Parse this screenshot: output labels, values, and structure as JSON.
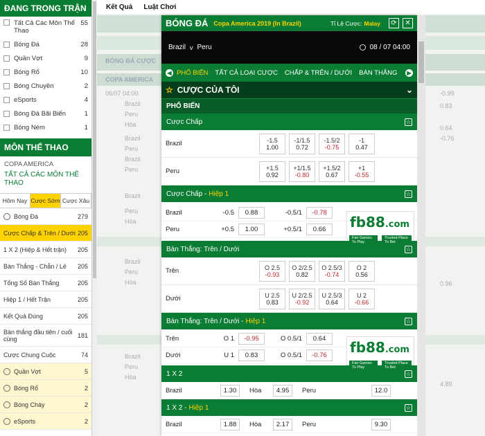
{
  "left": {
    "live_title": "ĐANG TRONG TRẬN",
    "live_items": [
      {
        "label": "Tất Cả Các Môn Thể Thao",
        "count": "55"
      },
      {
        "label": "Bóng Đá",
        "count": "28"
      },
      {
        "label": "Quần Vợt",
        "count": "9"
      },
      {
        "label": "Bóng Rổ",
        "count": "10"
      },
      {
        "label": "Bóng Chuyền",
        "count": "2"
      },
      {
        "label": "eSports",
        "count": "4"
      },
      {
        "label": "Bóng Đá Bãi Biển",
        "count": "1"
      },
      {
        "label": "Bóng Ném",
        "count": "1"
      }
    ],
    "sports_title": "MÔN THỂ THAO",
    "copa": "COPA AMERICA",
    "all_sports": "TẤT CẢ CÁC MÔN THỂ THAO",
    "tabs": [
      "Hôm Nay",
      "Cược Sớm",
      "Cược Xâu"
    ],
    "sport_items": [
      {
        "label": "Bóng Đá",
        "count": "279"
      },
      {
        "label": "Cược Chấp & Trên / Dưới",
        "count": "205"
      },
      {
        "label": "1 X 2 (Hiệp & Hết trận)",
        "count": "205"
      },
      {
        "label": "Bàn Thắng - Chẵn / Lẻ",
        "count": "205"
      },
      {
        "label": "Tổng Số Bàn Thắng",
        "count": "205"
      },
      {
        "label": "Hiệp 1 / Hết Trận",
        "count": "205"
      },
      {
        "label": "Kết Quả Đúng",
        "count": "205"
      },
      {
        "label": "Bàn thắng đầu tiên / cuối cùng",
        "count": "181"
      },
      {
        "label": "Cược Chung Cuộc",
        "count": "74"
      },
      {
        "label": "Quần Vợt",
        "count": "5"
      },
      {
        "label": "Bóng Rổ",
        "count": "2"
      },
      {
        "label": "Bóng Chày",
        "count": "2"
      },
      {
        "label": "eSports",
        "count": "2"
      }
    ]
  },
  "topnav": {
    "results": "Kết Quả",
    "rules": "Luật Chơi"
  },
  "bg": {
    "sec1": "BÓNG ĐÁ CƯỢC",
    "sec2": "COPA AMERICA",
    "bg_texts": [
      "Brazil",
      "Peru",
      "Hòa",
      "Brazil",
      "Peru",
      "Brazil",
      "Peru",
      "Brazil",
      "Peru",
      "Hòa",
      "06/07 04:00",
      "Brazil",
      "Peru",
      "Hòa",
      "Brazil",
      "Peru",
      "Hòa"
    ],
    "right_vals": [
      "-0.99",
      "0.83",
      "0.64",
      "-0.76",
      "0.96",
      "4.89"
    ]
  },
  "modal": {
    "title": "BÓNG ĐÁ",
    "league": "Copa America 2019 (In Brazil)",
    "odds_label": "Tỉ Lệ Cược:",
    "odds_type": "Malay",
    "home": "Brazil",
    "vs": "v",
    "away": "Peru",
    "datetime": "08 / 07  04:00",
    "tabs": [
      "PHỔ BIẾN",
      "TẤT CẢ LOẠI CƯỢC",
      "CHẤP & TRÊN / DƯỚI",
      "BÀN THẮNG"
    ],
    "my_bets": "CƯỢC CỦA TÔI",
    "popular": "PHỔ BIẾN",
    "handicap": {
      "title": "Cược Chấp",
      "rows": [
        {
          "team": "Brazil",
          "odds": [
            [
              "-1.5",
              "1.00"
            ],
            [
              "-1/1.5",
              "0.72"
            ],
            [
              "-1.5/2",
              "-0.75"
            ],
            [
              "-1",
              "0.47"
            ]
          ]
        },
        {
          "team": "Peru",
          "odds": [
            [
              "+1.5",
              "0.92"
            ],
            [
              "+1/1.5",
              "-0.80"
            ],
            [
              "+1.5/2",
              "0.67"
            ],
            [
              "+1",
              "-0.55"
            ]
          ]
        }
      ]
    },
    "handicap_h1": {
      "title": "Cược Chấp -",
      "suffix": "Hiệp 1",
      "rows": [
        {
          "team": "Brazil",
          "h1": "-0.5",
          "v1": "0.88",
          "h2": "-0.5/1",
          "v2": "-0.78"
        },
        {
          "team": "Peru",
          "h1": "+0.5",
          "v1": "1.00",
          "h2": "+0.5/1",
          "v2": "0.66"
        }
      ]
    },
    "goals": {
      "title": "Bàn Thắng: Trên / Dưới",
      "rows": [
        {
          "team": "Trên",
          "odds": [
            [
              "O 2.5",
              "-0.93"
            ],
            [
              "O 2/2.5",
              "0.82"
            ],
            [
              "O 2.5/3",
              "-0.74"
            ],
            [
              "O 2",
              "0.56"
            ]
          ]
        },
        {
          "team": "Dưới",
          "odds": [
            [
              "U 2.5",
              "0.83"
            ],
            [
              "U 2/2.5",
              "-0.92"
            ],
            [
              "U 2.5/3",
              "0.64"
            ],
            [
              "U 2",
              "-0.66"
            ]
          ]
        }
      ]
    },
    "goals_h1": {
      "title": "Bàn Thắng: Trên / Dưới -",
      "suffix": "Hiệp 1",
      "rows": [
        {
          "team": "Trên",
          "h1": "O 1",
          "v1": "-0.95",
          "h2": "O 0.5/1",
          "v2": "0.64"
        },
        {
          "team": "Dưới",
          "h1": "U 1",
          "v1": "0.83",
          "h2": "O 0.5/1",
          "v2": "-0.76"
        }
      ]
    },
    "x12": {
      "title": "1 X 2",
      "home": "Brazil",
      "home_odds": "1.30",
      "draw": "Hòa",
      "draw_odds": "4.95",
      "away": "Peru",
      "away_odds": "12.0"
    },
    "x12_h1": {
      "title": "1 X 2 -",
      "suffix": "Hiệp 1",
      "home": "Brazil",
      "home_odds": "1.88",
      "draw": "Hòa",
      "draw_odds": "2.17",
      "away": "Peru",
      "away_odds": "9.30"
    },
    "ad": {
      "logo": "fb88",
      "dom": ".com",
      "slogan1": "Fair Games To Play",
      "slogan2": "Trusted Place To Bet"
    }
  },
  "colors": {
    "green": "#0b7c33",
    "yellow": "#ffd200",
    "red": "#c0272d"
  }
}
